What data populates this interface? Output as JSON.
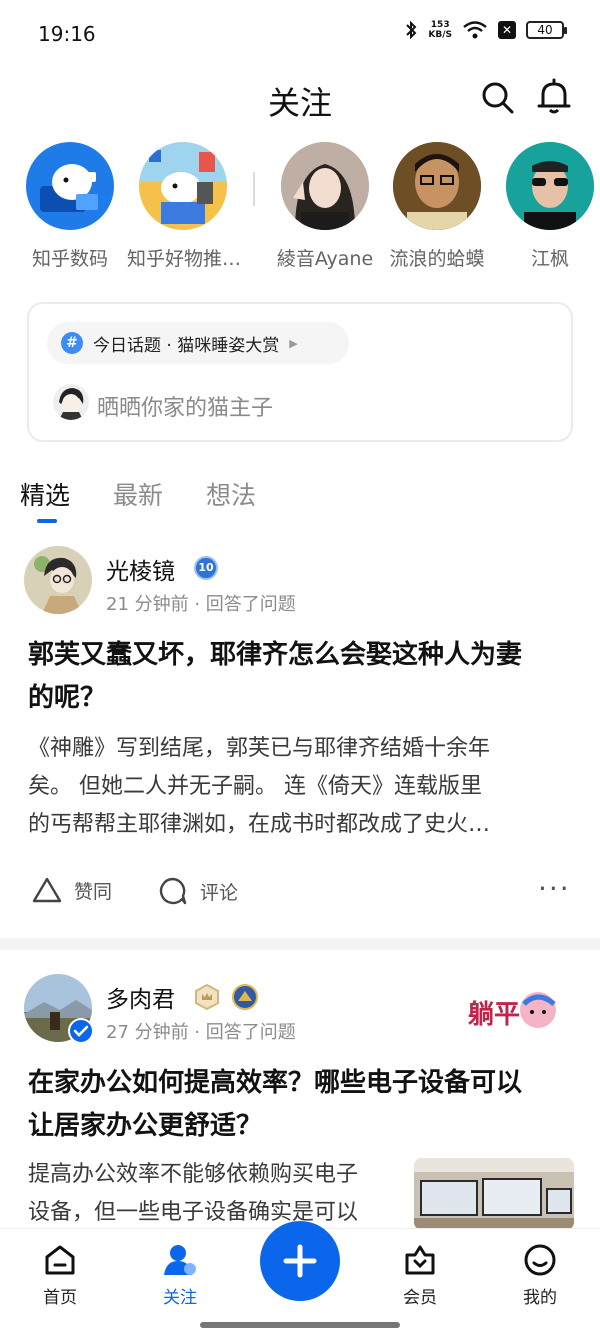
{
  "status_bar": {
    "time": "19:16",
    "net_speed_value": "153",
    "net_speed_unit": "KB/S",
    "battery": "40",
    "icons": [
      "bluetooth-icon",
      "wifi-icon",
      "x-app-icon",
      "battery-icon"
    ]
  },
  "header": {
    "title": "关注",
    "icons": [
      "search-icon",
      "bell-icon"
    ]
  },
  "stories": [
    {
      "name": "知乎数码"
    },
    {
      "name": "知乎好物推…"
    },
    {
      "name": "綾音Ayane"
    },
    {
      "name": "流浪的蛤蟆"
    },
    {
      "name": "江枫"
    }
  ],
  "topic_card": {
    "topic": "今日话题 · 猫咪睡姿大赏",
    "placeholder": "晒晒你家的猫主子"
  },
  "tabs": [
    {
      "label": "精选",
      "active": true
    },
    {
      "label": "最新",
      "active": false
    },
    {
      "label": "想法",
      "active": false
    }
  ],
  "feed": [
    {
      "author": "光棱镜",
      "badge": "10",
      "meta": "21 分钟前 · 回答了问题",
      "title_lines": [
        "郭芙又蠢又坏，耶律齐怎么会娶这种人为妻",
        "的呢？"
      ],
      "excerpt_lines": [
        "《神雕》写到结尾，郭芙已与耶律齐结婚十余年",
        "矣。 但她二人并无子嗣。 连《倚天》连载版里",
        "的丐帮帮主耶律渊如，在成书时都改成了史火…"
      ],
      "actions": {
        "upvote": "赞同",
        "comment": "评论",
        "more": "···"
      }
    },
    {
      "author": "多肉君",
      "meta": "27 分钟前 · 回答了问题",
      "sticker": "躺平",
      "title_lines": [
        "在家办公如何提高效率？哪些电子设备可以",
        "让居家办公更舒适？"
      ],
      "excerpt_lines": [
        "提高办公效率不能够依赖购买电子",
        "设备，但一些电子设备确实是可以"
      ]
    }
  ],
  "bottom_nav": [
    {
      "label": "首页",
      "icon": "home-icon",
      "active": false
    },
    {
      "label": "关注",
      "icon": "following-icon",
      "active": true
    },
    {
      "label": "",
      "icon": "plus-icon",
      "active": false
    },
    {
      "label": "会员",
      "icon": "vip-icon",
      "active": false
    },
    {
      "label": "我的",
      "icon": "profile-icon",
      "active": false
    }
  ],
  "colors": {
    "accent": "#0a66ea",
    "text_primary": "#121212",
    "text_secondary": "#8b8b8b"
  }
}
